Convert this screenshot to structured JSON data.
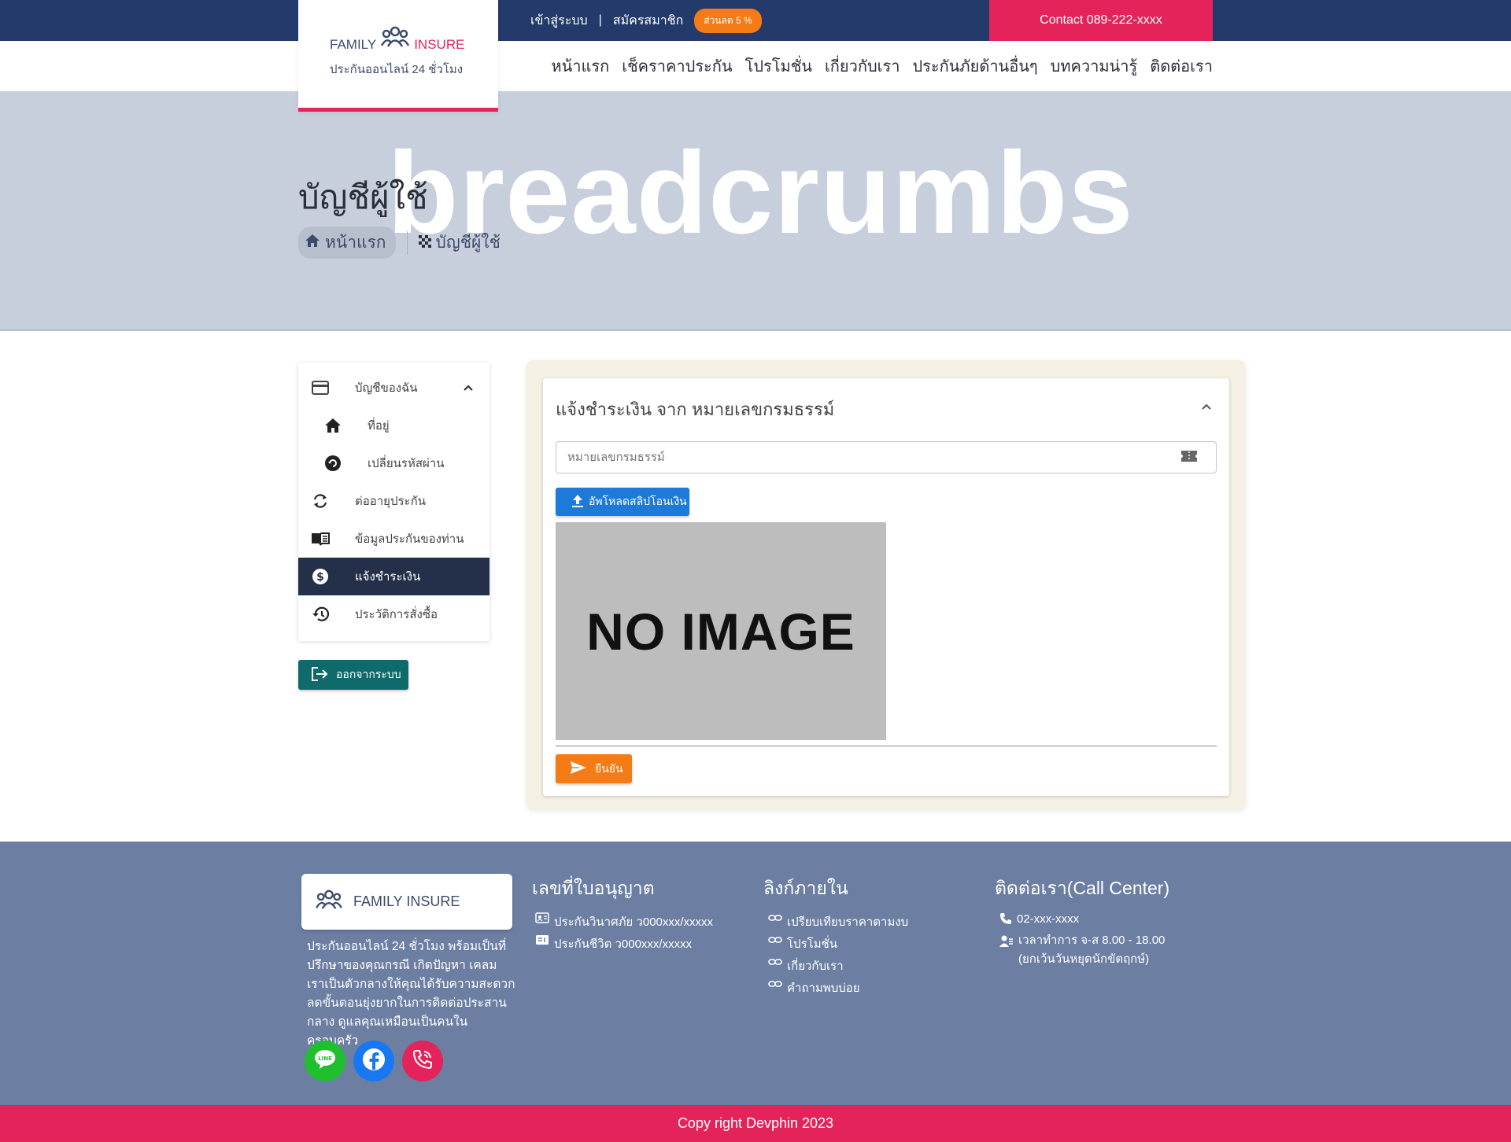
{
  "topbar": {
    "login": "เข้าสู่ระบบ",
    "separator": "|",
    "register": "สมัครสมาชิก",
    "discount_badge": "ส่วนลด 5 %",
    "contact": "Contact 089-222-xxxx"
  },
  "logo": {
    "family": "FAMILY",
    "insure": "INSURE",
    "subtitle": "ประกันออนไลน์ 24 ชั่วโมง",
    "icon": "family-group-icon"
  },
  "nav": {
    "items": [
      "หน้าแรก",
      "เช็คราคาประกัน",
      "โปรโมชั่น",
      "เกี่ยวกับเรา",
      "ประกันภัยด้านอื่นๆ",
      "บทความน่ารู้",
      "ติดต่อเรา"
    ]
  },
  "hero": {
    "watermark": "breadcrumbs",
    "title": "บัญชีผู้ใช้",
    "breadcrumb_home": "หน้าแรก",
    "breadcrumb_current": "บัญชีผู้ใช้"
  },
  "sidebar": {
    "items": [
      {
        "label": "บัญชีของฉัน",
        "icon": "credit-card-icon"
      },
      {
        "label": "ที่อยู่",
        "icon": "home-icon"
      },
      {
        "label": "เปลี่ยนรหัสผ่าน",
        "icon": "lock-reset-icon"
      },
      {
        "label": "ต่ออายุประกัน",
        "icon": "refresh-icon"
      },
      {
        "label": "ข้อมูลประกันของท่าน",
        "icon": "book-icon"
      },
      {
        "label": "แจ้งชำระเงิน",
        "icon": "dollar-icon"
      },
      {
        "label": "ประวัติการสั่งซื้อ",
        "icon": "history-icon"
      }
    ],
    "active_index": 5,
    "logout": "ออกจากระบบ"
  },
  "payment": {
    "title": "แจ้งชำระเงิน จาก หมายเลขกรมธรรม์",
    "policy_placeholder": "หมายเลขกรมธรรม์",
    "policy_value": "",
    "upload_label": "อัพโหลดสลิปโอนเงิน",
    "no_image": "NO IMAGE",
    "confirm_label": "ยืนยัน"
  },
  "footer": {
    "brand": "FAMILY INSURE",
    "about": "ประกันออนไลน์ 24 ชั่วโมง พร้อมเป็นที่ปรึกษาของคุณกรณี เกิดปัญหา เคลม เราเป็นตัวกลางให้คุณได้รับความสะดวก ลดขั้นตอนยุ่งยากในการติดต่อประสานกลาง ดูแลคุณเหมือนเป็นคนในครอบครัว",
    "license": {
      "title": "เลขที่ใบอนุญาต",
      "items": [
        "ประกันวินาศภัย ว000xxx/xxxxx",
        "ประกันชีวิต ว000xxx/xxxxx"
      ]
    },
    "links": {
      "title": "ลิงก์ภายใน",
      "items": [
        "เปรียบเทียบราคาตามงบ",
        "โปรโมชั่น",
        "เกี่ยวกับเรา",
        "คำถามพบบ่อย"
      ]
    },
    "contact": {
      "title": "ติดต่อเรา(Call Center)",
      "phone": "02-xxx-xxxx",
      "hours_1": "เวลาทำการ จ-ส 8.00 - 18.00",
      "hours_2": "(ยกเว้นวันหยุดนักขัตฤกษ์)"
    },
    "copyright": "Copy right Devphin 2023"
  },
  "colors": {
    "navy": "#243a6a",
    "pink": "#e3235a",
    "orange": "#f47b16",
    "blue": "#1d7ad9",
    "teal": "#0f6b6b",
    "footer": "#6c7fa3"
  }
}
